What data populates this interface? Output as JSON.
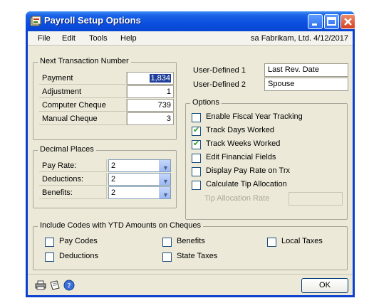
{
  "window": {
    "title": "Payroll Setup Options",
    "buttons": [
      "minimize",
      "maximize",
      "close"
    ]
  },
  "menu": {
    "items": [
      "File",
      "Edit",
      "Tools",
      "Help"
    ],
    "user_info": "sa  Fabrikam, Ltd.  4/12/2017"
  },
  "next_transaction": {
    "title": "Next Transaction Number",
    "rows": [
      {
        "label": "Payment",
        "value": "1,834"
      },
      {
        "label": "Adjustment",
        "value": "1"
      },
      {
        "label": "Computer Cheque",
        "value": "739"
      },
      {
        "label": "Manual Cheque",
        "value": "3"
      }
    ]
  },
  "decimal_places": {
    "title": "Decimal Places",
    "rows": [
      {
        "label": "Pay Rate:",
        "value": "2"
      },
      {
        "label": "Deductions:",
        "value": "2"
      },
      {
        "label": "Benefits:",
        "value": "2"
      }
    ]
  },
  "user_defined": [
    {
      "label": "User-Defined 1",
      "value": "Last Rev. Date"
    },
    {
      "label": "User-Defined 2",
      "value": "Spouse"
    }
  ],
  "options": {
    "title": "Options",
    "items": [
      {
        "label": "Enable Fiscal Year Tracking",
        "checked": false
      },
      {
        "label": "Track Days Worked",
        "checked": true
      },
      {
        "label": "Track Weeks Worked",
        "checked": true
      },
      {
        "label": "Edit Financial Fields",
        "checked": false
      },
      {
        "label": "Display Pay Rate on Trx",
        "checked": false
      },
      {
        "label": "Calculate Tip Allocation",
        "checked": false
      }
    ],
    "tip_rate_label": "Tip Allocation Rate",
    "tip_rate_value": ""
  },
  "ytd_codes": {
    "title": "Include Codes with YTD Amounts on Cheques",
    "items": [
      {
        "label": "Pay Codes",
        "checked": false
      },
      {
        "label": "Deductions",
        "checked": false
      },
      {
        "label": "Benefits",
        "checked": false
      },
      {
        "label": "State Taxes",
        "checked": false
      },
      {
        "label": "Local Taxes",
        "checked": false
      }
    ]
  },
  "footer": {
    "ok_label": "OK",
    "icons": [
      "printer-icon",
      "note-icon",
      "help-icon"
    ]
  },
  "colors": {
    "titlebar": "#0b4fe0",
    "dialog_bg": "#ece9d8",
    "check": "#21a121"
  }
}
